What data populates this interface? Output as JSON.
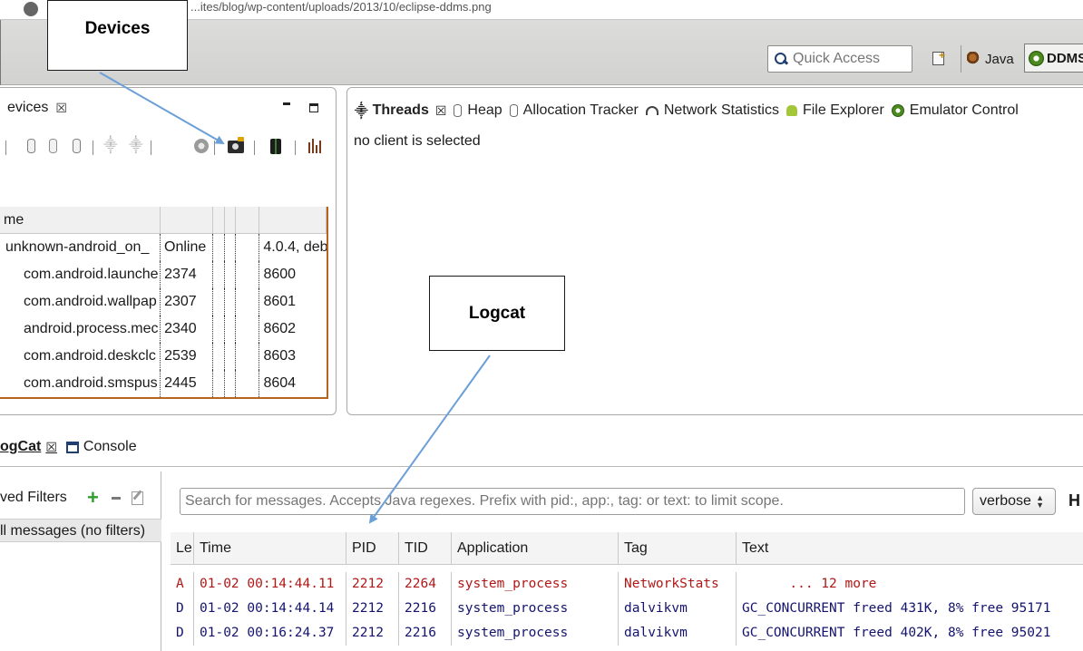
{
  "browser": {
    "url_fragment": "...ites/blog/wp-content/uploads/2013/10/eclipse-ddms.png"
  },
  "toolbar": {
    "quick_access_placeholder": "Quick Access",
    "perspectives": [
      {
        "label": "Java",
        "icon": "java-perspective-icon"
      },
      {
        "label": "DDMS",
        "icon": "ddms-perspective-icon",
        "active": true
      }
    ]
  },
  "callouts": {
    "devices": "Devices",
    "logcat": "Logcat"
  },
  "devices_view": {
    "tab_label": "evices",
    "table": {
      "columns": [
        "me",
        "",
        "",
        "",
        "",
        ""
      ],
      "device": {
        "name": "unknown-android_on_",
        "status": "Online",
        "version": "4.0.4, deb"
      },
      "clients": [
        {
          "name": "com.android.launche",
          "pid": "2374",
          "port": "8600"
        },
        {
          "name": "com.android.wallpap",
          "pid": "2307",
          "port": "8601"
        },
        {
          "name": "android.process.mec",
          "pid": "2340",
          "port": "8602"
        },
        {
          "name": "com.android.deskclc",
          "pid": "2539",
          "port": "8603"
        },
        {
          "name": "com.android.smspus",
          "pid": "2445",
          "port": "8604"
        }
      ]
    }
  },
  "threads_view": {
    "tabs": [
      {
        "label": "Threads",
        "icon": "threads-icon",
        "active": true
      },
      {
        "label": "Heap",
        "icon": "heap-icon"
      },
      {
        "label": "Allocation Tracker",
        "icon": "allocation-tracker-icon"
      },
      {
        "label": "Network Statistics",
        "icon": "network-statistics-icon"
      },
      {
        "label": "File Explorer",
        "icon": "file-explorer-icon"
      },
      {
        "label": "Emulator Control",
        "icon": "emulator-control-icon"
      }
    ],
    "message": "no client is selected"
  },
  "logcat_view": {
    "tabs": [
      {
        "label": "ogCat",
        "active": true
      },
      {
        "label": "Console",
        "icon": "console-icon"
      }
    ],
    "filters_label": "ved Filters",
    "filters": [
      "ll messages (no filters)"
    ],
    "search_placeholder": "Search for messages. Accepts Java regexes. Prefix with pid:, app:, tag: or text: to limit scope.",
    "level": "verbose",
    "extra_button": "H",
    "columns": [
      "Le",
      "Time",
      "PID",
      "TID",
      "Application",
      "Tag",
      "Text"
    ],
    "rows": [
      {
        "level": "A",
        "time": "01-02 00:14:44.11",
        "pid": "2212",
        "tid": "2264",
        "app": "system_process",
        "tag": "NetworkStats",
        "text": "      ... 12 more"
      },
      {
        "level": "D",
        "time": "01-02 00:14:44.14",
        "pid": "2212",
        "tid": "2216",
        "app": "system_process",
        "tag": "dalvikvm",
        "text": "GC_CONCURRENT freed 431K, 8% free 95171"
      },
      {
        "level": "D",
        "time": "01-02 00:16:24.37",
        "pid": "2212",
        "tid": "2216",
        "app": "system_process",
        "tag": "dalvikvm",
        "text": "GC_CONCURRENT freed 402K, 8% free 95021"
      }
    ]
  },
  "colors": {
    "warn_text": "#b01818",
    "debug_text": "#14146e",
    "annotation_arrow": "#6a9fd8",
    "table_accent": "#b5651d"
  }
}
